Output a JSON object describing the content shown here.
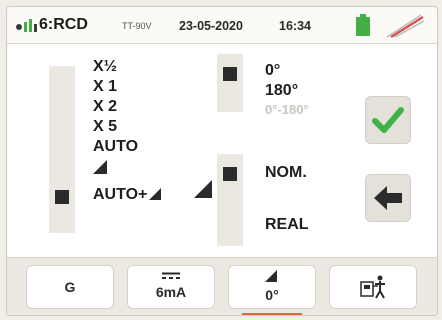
{
  "header": {
    "mode": "6:RCD",
    "network": "TT-90V",
    "date": "23-05-2020",
    "time": "16:34",
    "battery_icon": "battery-icon",
    "status_icon": "slash-icon"
  },
  "multiplier": {
    "options": [
      "X½",
      "X 1",
      "X 2",
      "X 5",
      "AUTO",
      "",
      "AUTO+"
    ],
    "selected": "AUTO+"
  },
  "phase": {
    "options": [
      "0°",
      "180°",
      "0°-180°"
    ],
    "selected": "0°"
  },
  "mode_select": {
    "options": [
      "NOM.",
      "REAL"
    ],
    "selected": "NOM."
  },
  "side_buttons": {
    "confirm_icon": "checkmark-icon",
    "back_icon": "left-arrow-icon"
  },
  "soft_keys": {
    "ground": "G",
    "current": "6mA",
    "phase": "0°",
    "test_icon": "test-setup-icon"
  },
  "colors": {
    "check": "#3fb34a",
    "accent_underline": "#e2643c",
    "battery": "#43b047",
    "slash": "#d9534f"
  }
}
